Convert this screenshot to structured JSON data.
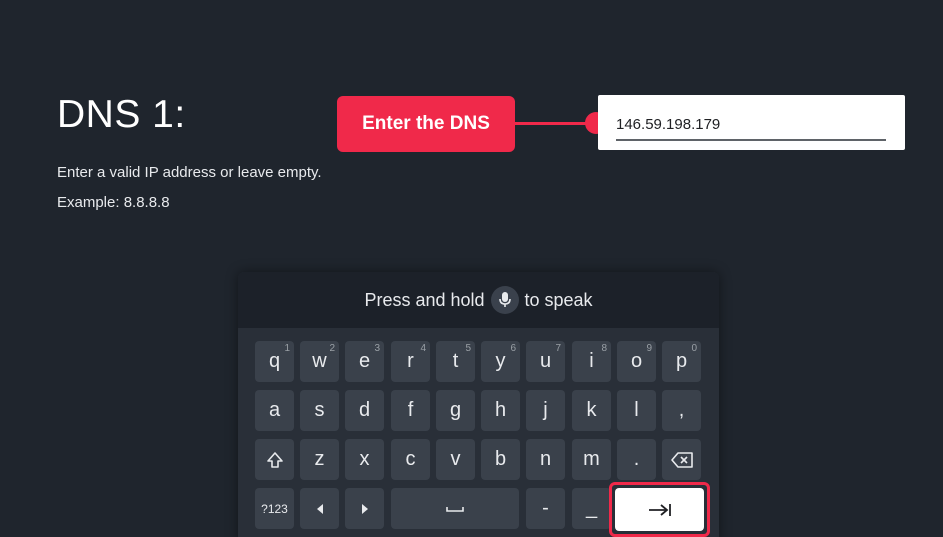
{
  "page": {
    "title": "DNS 1:",
    "hint_line1": "Enter a valid IP address or leave empty.",
    "hint_line2": "Example: 8.8.8.8"
  },
  "callout": {
    "label": "Enter the DNS"
  },
  "dns_field": {
    "value": "146.59.198.179"
  },
  "keyboard": {
    "voice_prefix": "Press and hold",
    "voice_suffix": "to speak",
    "row1": [
      {
        "key": "q",
        "alt": "1"
      },
      {
        "key": "w",
        "alt": "2"
      },
      {
        "key": "e",
        "alt": "3"
      },
      {
        "key": "r",
        "alt": "4"
      },
      {
        "key": "t",
        "alt": "5"
      },
      {
        "key": "y",
        "alt": "6"
      },
      {
        "key": "u",
        "alt": "7"
      },
      {
        "key": "i",
        "alt": "8"
      },
      {
        "key": "o",
        "alt": "9"
      },
      {
        "key": "p",
        "alt": "0"
      }
    ],
    "row2": [
      "a",
      "s",
      "d",
      "f",
      "g",
      "h",
      "j",
      "k",
      "l",
      ","
    ],
    "row3": [
      "z",
      "x",
      "c",
      "v",
      "b",
      "n",
      "m",
      "."
    ],
    "symbols_label": "?123",
    "dash_label": "-",
    "underscore_label": "_"
  },
  "colors": {
    "background": "#1f252d",
    "accent": "#f0294a",
    "key": "#3a414b",
    "keyboard": "#292f38"
  },
  "icons": {
    "mic": "microphone-icon",
    "shift": "shift-icon",
    "backspace": "backspace-icon",
    "left": "arrow-left-icon",
    "right": "arrow-right-icon",
    "space": "space-icon",
    "enter": "tab-next-icon"
  }
}
